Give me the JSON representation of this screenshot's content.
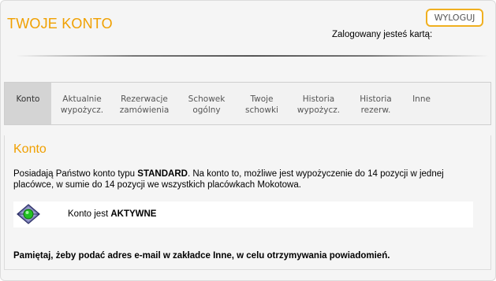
{
  "header": {
    "title": "TWOJE KONTO",
    "logout_label": "WYLOGUJ",
    "login_info": "Zalogowany jesteś kartą:"
  },
  "tabs": [
    {
      "line1": "Konto",
      "line2": "",
      "active": true
    },
    {
      "line1": "Aktualnie",
      "line2": "wypożycz."
    },
    {
      "line1": "Rezerwacje",
      "line2": "zamówienia"
    },
    {
      "line1": "Schowek",
      "line2": "ogólny"
    },
    {
      "line1": "Twoje",
      "line2": "schowki"
    },
    {
      "line1": "Historia",
      "line2": "wypożycz."
    },
    {
      "line1": "Historia",
      "line2": "rezerw."
    },
    {
      "line1": "Inne",
      "line2": ""
    }
  ],
  "main": {
    "section_title": "Konto",
    "info_prefix": "Posiadają Państwo konto typu ",
    "account_type": "STANDARD",
    "info_suffix": ". Na konto to, możliwe jest wypożyczenie do 14 pozycji w jednej placówce, w sumie do 14 pozycji we wszystkich placówkach Mokotowa.",
    "status_prefix": "Konto jest ",
    "status_value": "AKTYWNE",
    "status_icon": "active-status-icon",
    "reminder": "Pamiętaj, żeby podać adres e-mail w zakładce Inne, w celu otrzymywania powiadomień."
  },
  "colors": {
    "accent": "#f0a000",
    "logout_border": "#f0b020",
    "active_tab": "#d4d4d4",
    "status_green": "#22c022"
  }
}
